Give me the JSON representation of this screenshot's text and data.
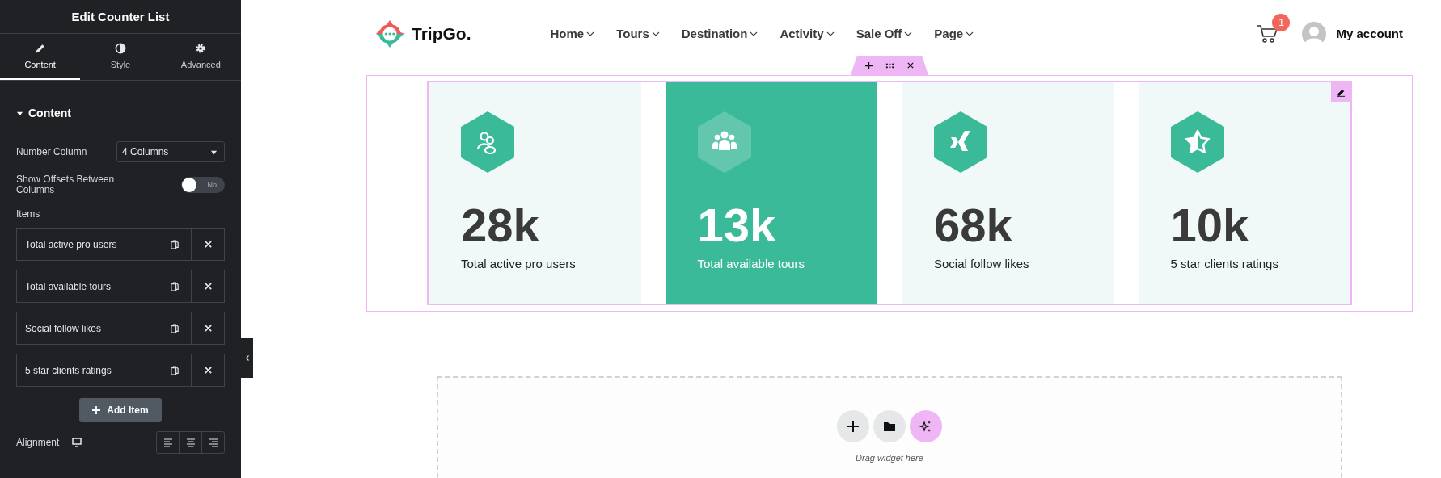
{
  "panel": {
    "title": "Edit Counter List",
    "tabs": [
      {
        "label": "Content",
        "kind": "pencil",
        "selected": true
      },
      {
        "label": "Style",
        "kind": "contrast",
        "selected": false
      },
      {
        "label": "Advanced",
        "kind": "gear",
        "selected": false
      }
    ],
    "section": {
      "title": "Content",
      "expanded": true
    },
    "number_column": {
      "label": "Number Column",
      "value": "4 Columns"
    },
    "offsets": {
      "label": "Show Offsets Between Columns",
      "on": false,
      "state_text": "No"
    },
    "items_label": "Items",
    "items": [
      {
        "label": "Total active pro users"
      },
      {
        "label": "Total available tours"
      },
      {
        "label": "Social follow likes"
      },
      {
        "label": "5 star clients ratings"
      }
    ],
    "add_button": "Add Item",
    "alignment": {
      "label": "Alignment",
      "options": [
        {
          "kind": "left"
        },
        {
          "kind": "center"
        },
        {
          "kind": "right"
        }
      ]
    }
  },
  "header": {
    "logo": "TripGo.",
    "nav": [
      {
        "label": "Home"
      },
      {
        "label": "Tours"
      },
      {
        "label": "Destination"
      },
      {
        "label": "Activity"
      },
      {
        "label": "Sale Off"
      },
      {
        "label": "Page"
      }
    ],
    "cart_count": "1",
    "account": "My account"
  },
  "counters": [
    {
      "number": "28k",
      "label": "Total active pro users",
      "kind": "users",
      "highlighted": false
    },
    {
      "number": "13k",
      "label": "Total available tours",
      "kind": "group",
      "highlighted": true
    },
    {
      "number": "68k",
      "label": "Social follow likes",
      "kind": "xing",
      "highlighted": false
    },
    {
      "number": "10k",
      "label": "5 star clients ratings",
      "kind": "star",
      "highlighted": false
    }
  ],
  "drop_zone": {
    "hint": "Drag widget here"
  }
}
